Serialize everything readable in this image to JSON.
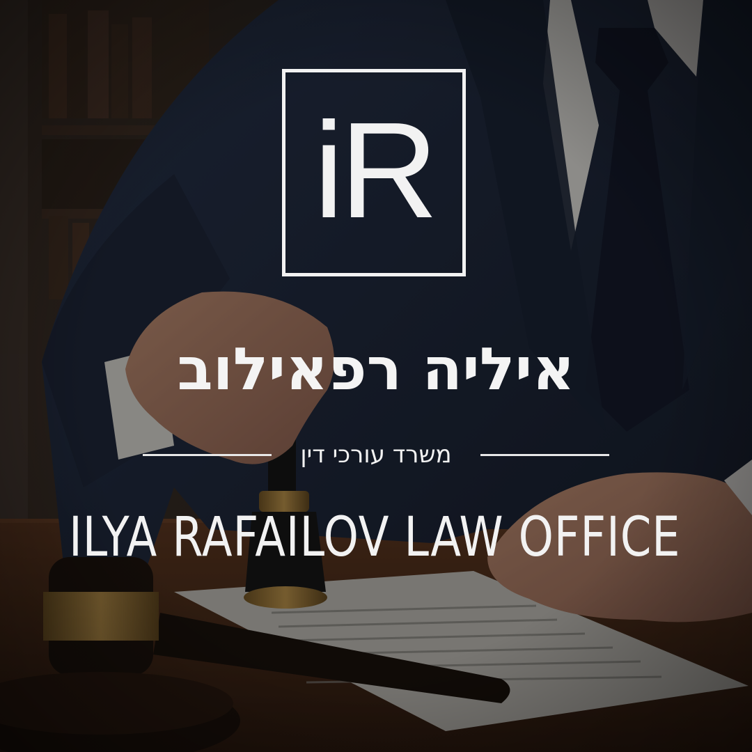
{
  "logo": {
    "mark": "iR"
  },
  "heading": {
    "name_he": "איליה רפאילוב"
  },
  "subheading": {
    "text_he": "משרד עורכי דין"
  },
  "footer_title": {
    "name_en": "ILYA RAFAILOV LAW OFFICE"
  },
  "photo": {
    "scene": "lawyer stamping a document at a desk",
    "objects": [
      "suit-jacket",
      "tie",
      "hands",
      "rubber-stamp",
      "document",
      "gavel",
      "bookshelf",
      "desk"
    ]
  },
  "colors": {
    "text": "#f2f2f2",
    "suit": "#1c2433",
    "desk": "#4a2c1a",
    "paper": "#bdbab4",
    "brass": "#a07a3a"
  }
}
